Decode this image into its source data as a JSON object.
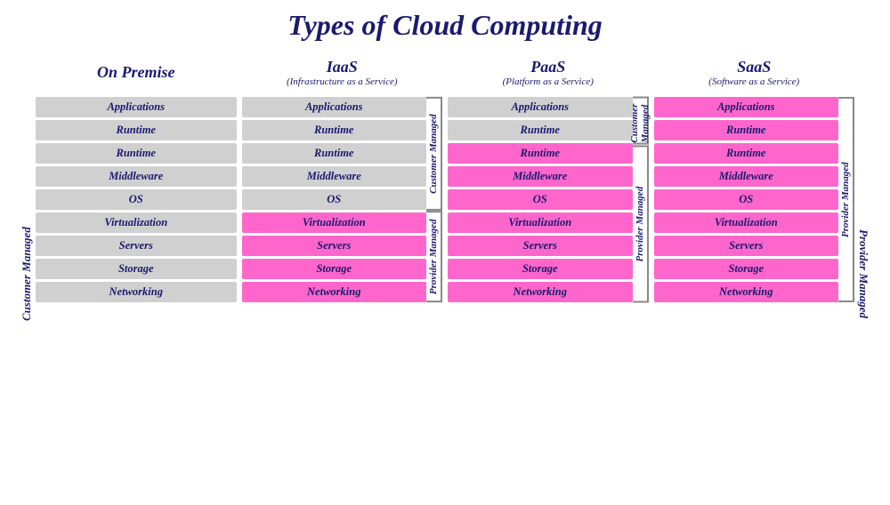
{
  "title": "Types of Cloud Computing",
  "columns": [
    {
      "id": "on-premise",
      "title": "On Premise",
      "subtitle": "",
      "leftLabel": "Customer Managed",
      "customerManagedRows": 9,
      "providerManagedRows": 0,
      "rows": [
        {
          "label": "Applications",
          "type": "gray"
        },
        {
          "label": "Runtime",
          "type": "gray"
        },
        {
          "label": "Runtime",
          "type": "gray"
        },
        {
          "label": "Middleware",
          "type": "gray"
        },
        {
          "label": "OS",
          "type": "gray"
        },
        {
          "label": "Virtualization",
          "type": "gray"
        },
        {
          "label": "Servers",
          "type": "gray"
        },
        {
          "label": "Storage",
          "type": "gray"
        },
        {
          "label": "Networking",
          "type": "gray"
        }
      ]
    },
    {
      "id": "iaas",
      "title": "IaaS",
      "subtitle": "(Infrastructure as a Service)",
      "customerLabel": "Customer Managed",
      "providerLabel": "Provider Managed",
      "customerManagedRows": 5,
      "providerManagedRows": 4,
      "rows": [
        {
          "label": "Applications",
          "type": "gray"
        },
        {
          "label": "Runtime",
          "type": "gray"
        },
        {
          "label": "Runtime",
          "type": "gray"
        },
        {
          "label": "Middleware",
          "type": "gray"
        },
        {
          "label": "OS",
          "type": "gray"
        },
        {
          "label": "Virtualization",
          "type": "pink"
        },
        {
          "label": "Servers",
          "type": "pink"
        },
        {
          "label": "Storage",
          "type": "pink"
        },
        {
          "label": "Networking",
          "type": "pink"
        }
      ]
    },
    {
      "id": "paas",
      "title": "PaaS",
      "subtitle": "(Platform as a Service)",
      "customerLabel": "Customer Managed",
      "providerLabel": "Provider Managed",
      "customerManagedRows": 2,
      "providerManagedRows": 7,
      "rows": [
        {
          "label": "Applications",
          "type": "gray"
        },
        {
          "label": "Runtime",
          "type": "gray"
        },
        {
          "label": "Runtime",
          "type": "pink"
        },
        {
          "label": "Middleware",
          "type": "pink"
        },
        {
          "label": "OS",
          "type": "pink"
        },
        {
          "label": "Virtualization",
          "type": "pink"
        },
        {
          "label": "Servers",
          "type": "pink"
        },
        {
          "label": "Storage",
          "type": "pink"
        },
        {
          "label": "Networking",
          "type": "pink"
        }
      ]
    },
    {
      "id": "saas",
      "title": "SaaS",
      "subtitle": "(Software as a Service)",
      "customerLabel": "",
      "providerLabel": "Provider Managed",
      "customerManagedRows": 0,
      "providerManagedRows": 9,
      "rows": [
        {
          "label": "Applications",
          "type": "pink"
        },
        {
          "label": "Runtime",
          "type": "pink"
        },
        {
          "label": "Runtime",
          "type": "pink"
        },
        {
          "label": "Middleware",
          "type": "pink"
        },
        {
          "label": "OS",
          "type": "pink"
        },
        {
          "label": "Virtualization",
          "type": "pink"
        },
        {
          "label": "Servers",
          "type": "pink"
        },
        {
          "label": "Storage",
          "type": "pink"
        },
        {
          "label": "Networking",
          "type": "pink"
        }
      ]
    }
  ]
}
